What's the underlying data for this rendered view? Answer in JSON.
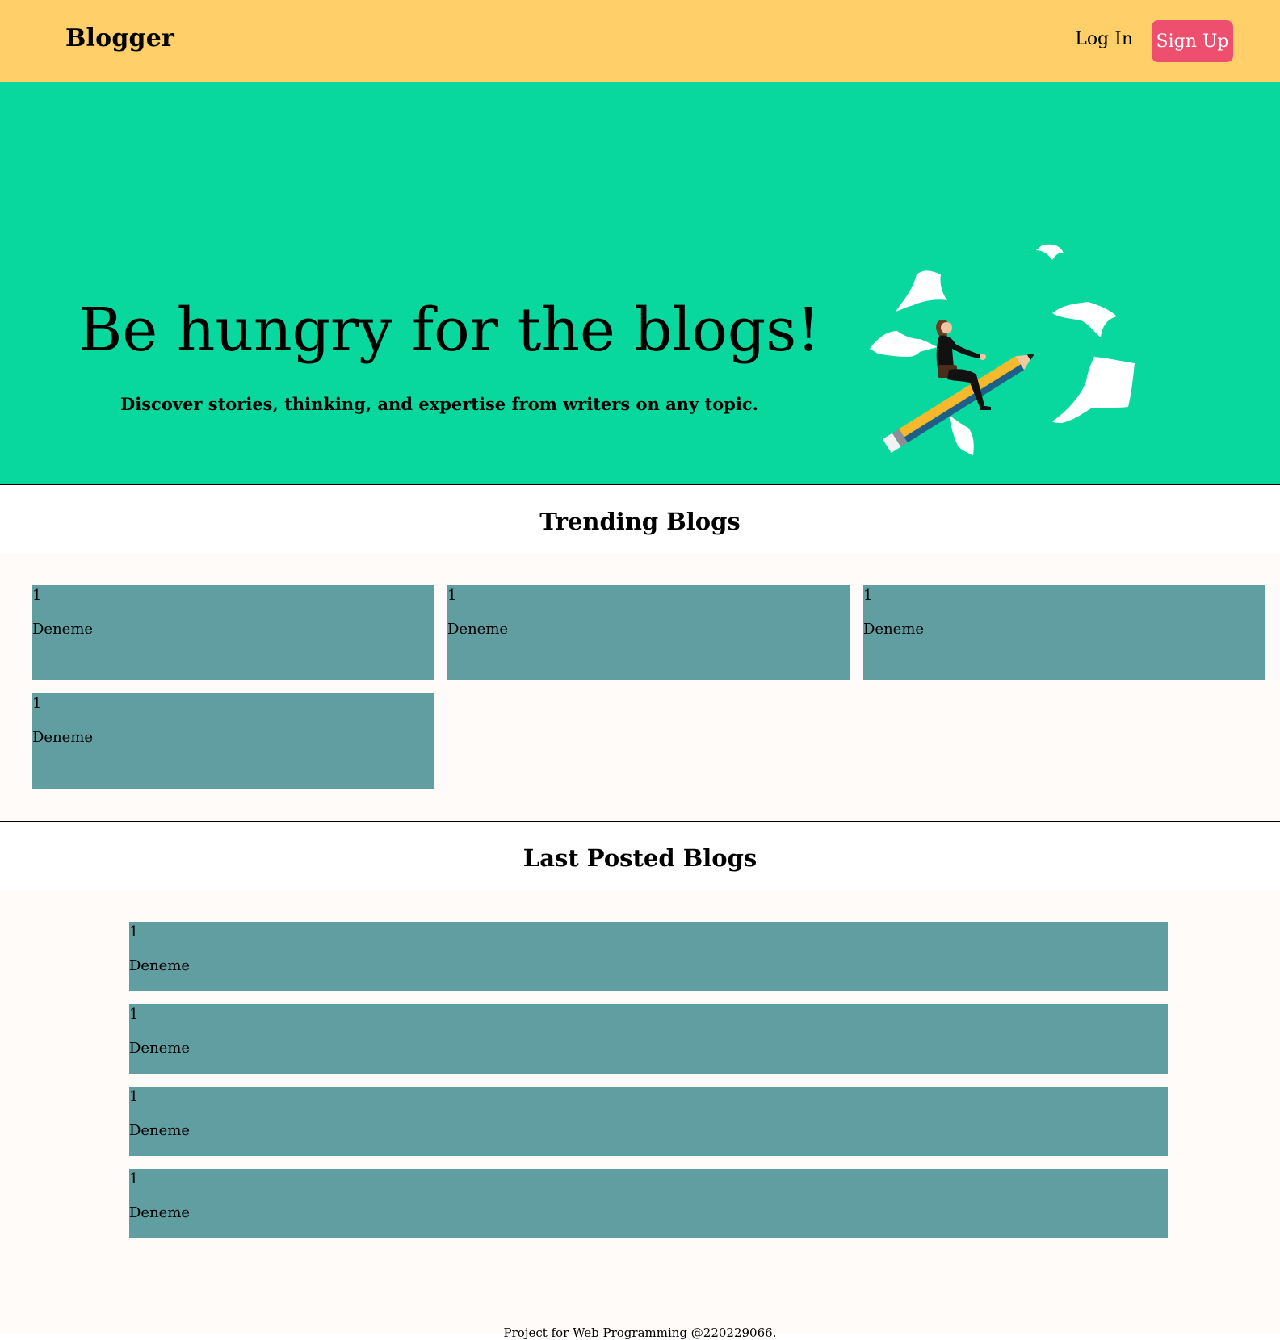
{
  "header": {
    "brand": "Blogger",
    "login_label": "Log In",
    "signup_label": "Sign Up"
  },
  "hero": {
    "title": "Be hungry for the blogs!",
    "subtitle": "Discover stories, thinking, and expertise from writers on any topic.",
    "illustration": "woman-riding-pencil-with-flying-papers"
  },
  "trending": {
    "title": "Trending Blogs",
    "items": [
      {
        "num": "1",
        "title": "Deneme"
      },
      {
        "num": "1",
        "title": "Deneme"
      },
      {
        "num": "1",
        "title": "Deneme"
      },
      {
        "num": "1",
        "title": "Deneme"
      }
    ]
  },
  "latest": {
    "title": "Last Posted Blogs",
    "items": [
      {
        "num": "1",
        "title": "Deneme"
      },
      {
        "num": "1",
        "title": "Deneme"
      },
      {
        "num": "1",
        "title": "Deneme"
      },
      {
        "num": "1",
        "title": "Deneme"
      }
    ]
  },
  "footer": {
    "text": "Project for Web Programming @220229066."
  },
  "colors": {
    "header_bg": "#ffd06a",
    "hero_bg": "#08d89e",
    "signup_bg": "#ef4f6f",
    "card_bg": "#609ea1",
    "section_bg": "#fefbf8"
  }
}
